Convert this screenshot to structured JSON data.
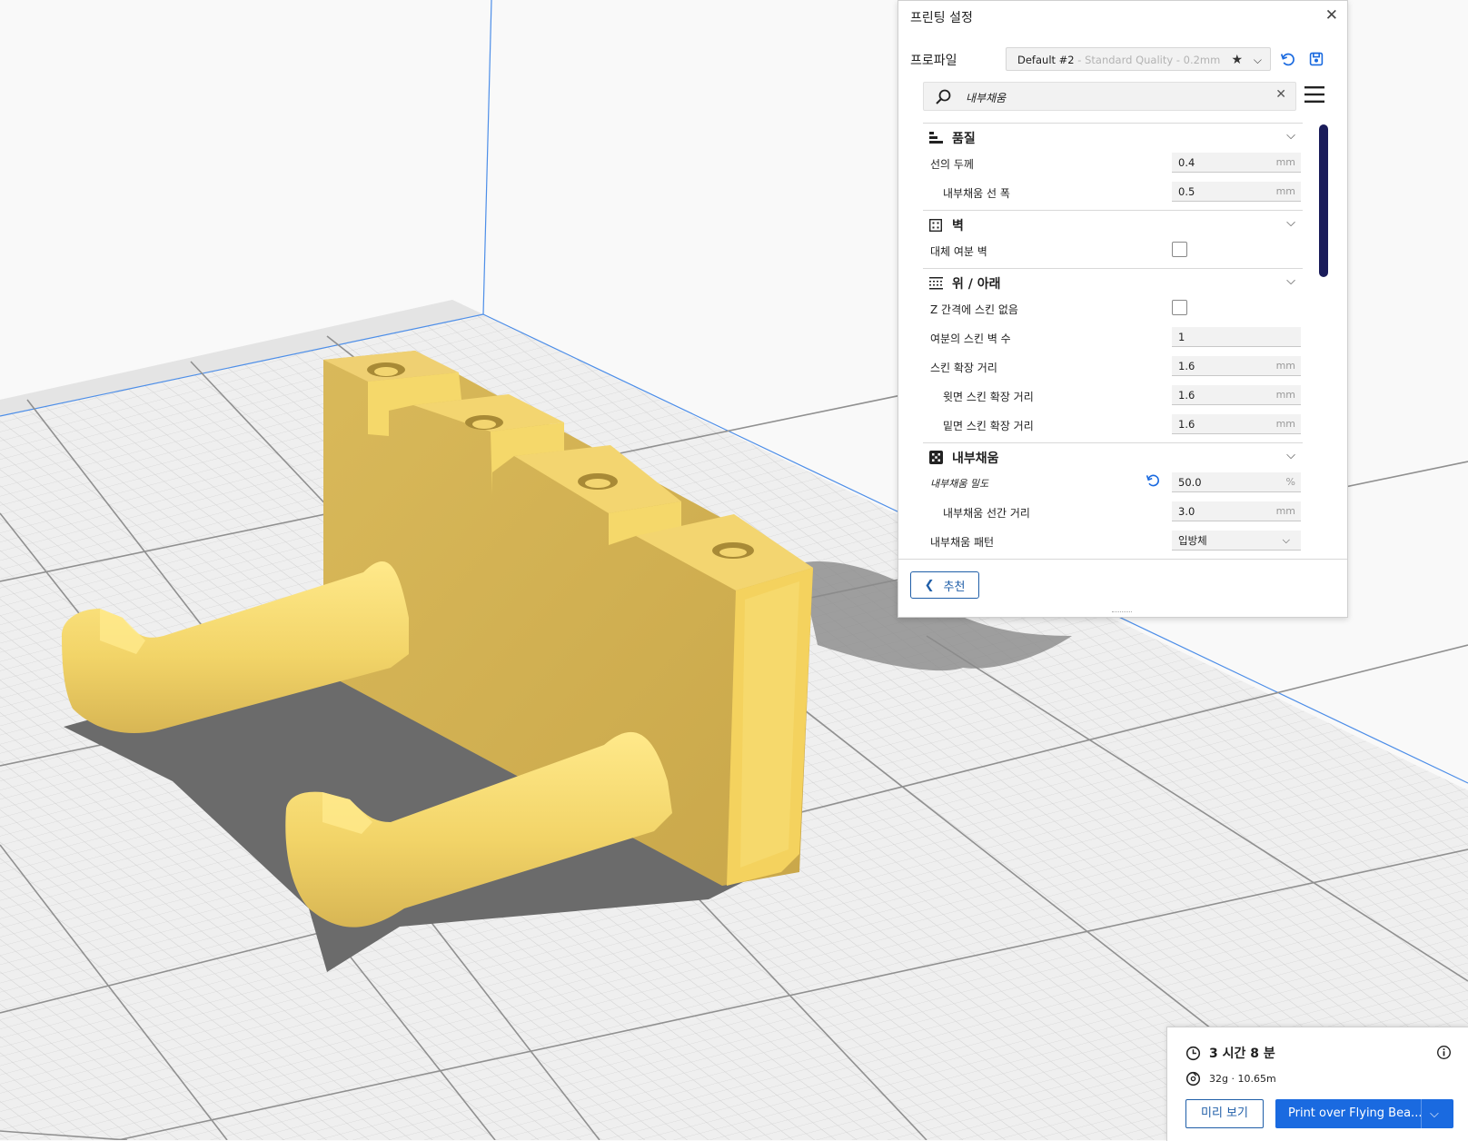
{
  "settings_panel": {
    "title": "프린팅 설정",
    "profile_label": "프로파일",
    "profile_name": "Default #2",
    "profile_sub": " - Standard Quality - 0.2mm",
    "search_value": "내부채움",
    "sections": [
      {
        "title": "품질",
        "icon": "quality-icon"
      },
      {
        "title": "벽",
        "icon": "walls-icon"
      },
      {
        "title": "위 / 아래",
        "icon": "top-bottom-icon"
      },
      {
        "title": "내부채움",
        "icon": "infill-icon"
      }
    ],
    "rows": [
      {
        "label": "선의 두께",
        "value": "0.4",
        "unit": "mm"
      },
      {
        "label": "내부채움 선 폭",
        "value": "0.5",
        "unit": "mm"
      },
      {
        "label": "대체 여분 벽",
        "checked": false
      },
      {
        "label": "Z 간격에 스킨 없음",
        "checked": false
      },
      {
        "label": "여분의 스킨 벽 수",
        "value": "1",
        "unit": ""
      },
      {
        "label": "스킨 확장 거리",
        "value": "1.6",
        "unit": "mm"
      },
      {
        "label": "윗면 스킨 확장 거리",
        "value": "1.6",
        "unit": "mm"
      },
      {
        "label": "밑면 스킨 확장 거리",
        "value": "1.6",
        "unit": "mm"
      },
      {
        "label": "내부채움 밀도",
        "value": "50.0",
        "unit": "%"
      },
      {
        "label": "내부채움 선간 거리",
        "value": "3.0",
        "unit": "mm"
      },
      {
        "label": "내부채움 패턴",
        "value": "입방체",
        "unit": ""
      }
    ],
    "recommended_label": "추천"
  },
  "job": {
    "time": "3 시간 8 분",
    "material": "32g · 10.65m",
    "preview_label": "미리 보기",
    "print_label": "Print over Flying Bea..."
  },
  "colors": {
    "model": "#f2d468",
    "accent": "#1a6ae0",
    "scrollbar": "#1a1c5a"
  }
}
